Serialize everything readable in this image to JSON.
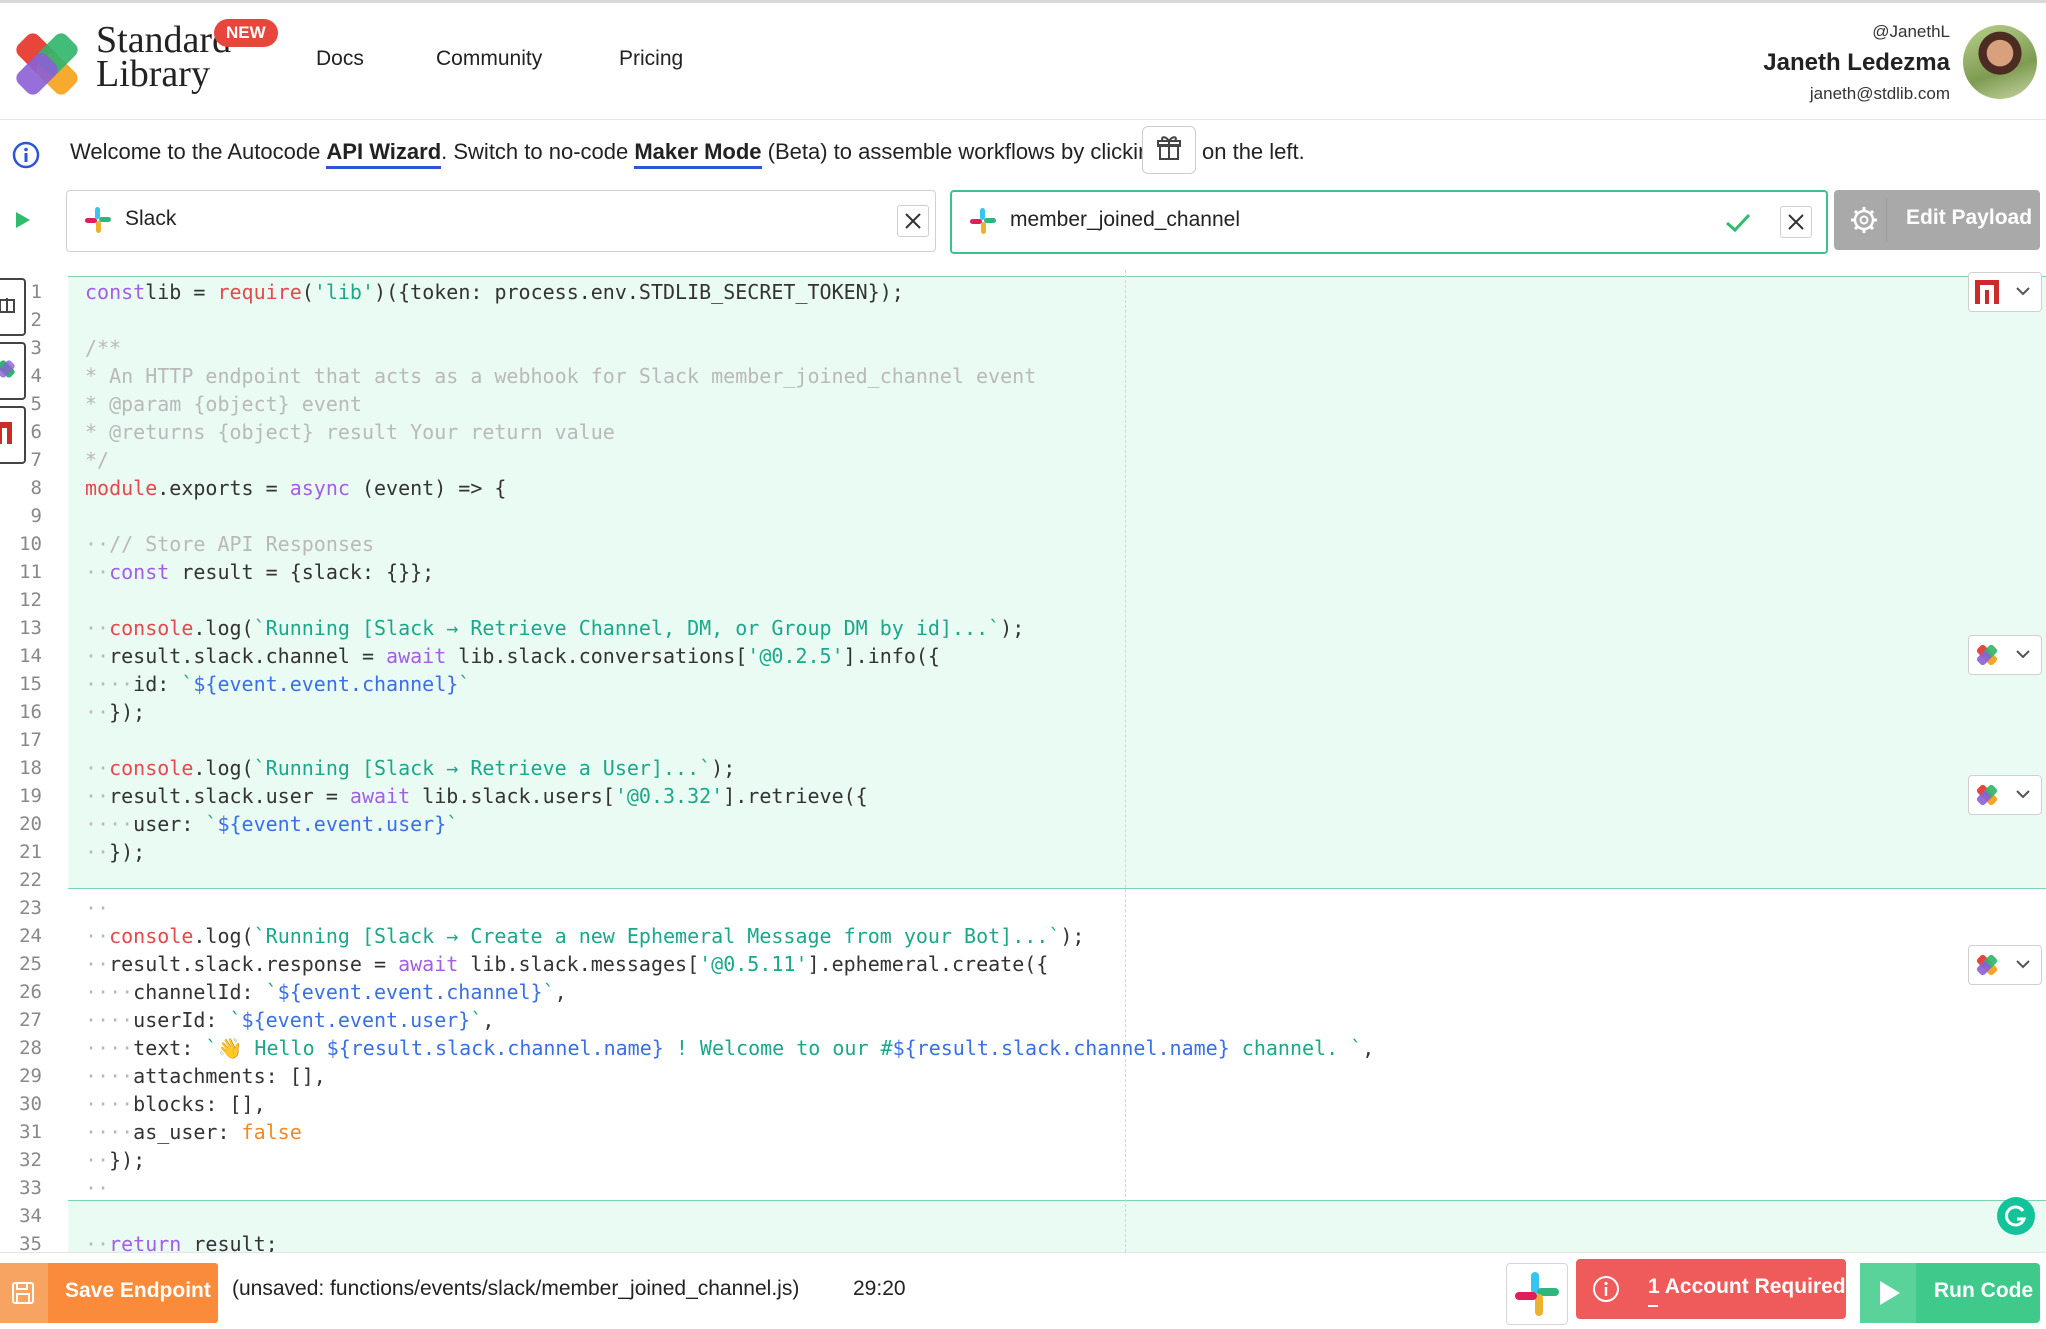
{
  "header": {
    "brand_line1": "Standard",
    "brand_line2": "Library",
    "new_badge": "NEW",
    "nav": [
      "Docs",
      "Community",
      "Pricing"
    ],
    "user": {
      "handle": "@JanethL",
      "name": "Janeth Ledezma",
      "email": "janeth@stdlib.com"
    }
  },
  "welcome": {
    "part1": "Welcome to the Autocode ",
    "api_wizard": "API Wizard",
    "part2": ". Switch to no-code ",
    "maker_mode": "Maker Mode",
    "part3": " (Beta) to assemble workflows by clicking",
    "part4": "on the left."
  },
  "selectors": {
    "api": "Slack",
    "event": "member_joined_channel",
    "edit_payload": "Edit Payload"
  },
  "editor": {
    "lines": [
      {
        "n": "1",
        "t": [
          [
            "k-kw",
            "const"
          ],
          [
            "",
            "lib = "
          ],
          [
            "k-red",
            "require"
          ],
          [
            "",
            "("
          ],
          [
            "k-str",
            "'lib'"
          ],
          [
            "",
            ")({token: process.env.STDLIB_SECRET_TOKEN});"
          ]
        ]
      },
      {
        "n": "2",
        "t": []
      },
      {
        "n": "3",
        "t": [
          [
            "k-com",
            "/**"
          ]
        ]
      },
      {
        "n": "4",
        "t": [
          [
            "k-com",
            "* An HTTP endpoint that acts as a webhook for Slack member_joined_channel event"
          ]
        ]
      },
      {
        "n": "5",
        "t": [
          [
            "k-com",
            "* @param {object} event"
          ]
        ]
      },
      {
        "n": "6",
        "t": [
          [
            "k-com",
            "* @returns {object} result Your return value"
          ]
        ]
      },
      {
        "n": "7",
        "t": [
          [
            "k-com",
            "*/"
          ]
        ]
      },
      {
        "n": "8",
        "t": [
          [
            "k-red",
            "module"
          ],
          [
            "",
            ".exports = "
          ],
          [
            "k-kw",
            "async"
          ],
          [
            "",
            " (event) => {"
          ]
        ]
      },
      {
        "n": "9",
        "t": []
      },
      {
        "n": "10",
        "t": [
          [
            "k-com",
            "··// Store API Responses"
          ]
        ]
      },
      {
        "n": "11",
        "t": [
          [
            "k-com",
            "··"
          ],
          [
            "k-kw",
            "const"
          ],
          [
            "",
            " result = {slack: {}};"
          ]
        ]
      },
      {
        "n": "12",
        "t": []
      },
      {
        "n": "13",
        "t": [
          [
            "k-com",
            "··"
          ],
          [
            "k-red",
            "console"
          ],
          [
            "",
            ".log("
          ],
          [
            "k-str",
            "`Running [Slack → Retrieve Channel, DM, or Group DM by id]...`"
          ],
          [
            "",
            ");"
          ]
        ]
      },
      {
        "n": "14",
        "t": [
          [
            "k-com",
            "··"
          ],
          [
            "",
            "result.slack.channel = "
          ],
          [
            "k-kw",
            "await"
          ],
          [
            "",
            " lib.slack.conversations["
          ],
          [
            "k-str",
            "'@0.2.5'"
          ],
          [
            "",
            "].info({"
          ]
        ]
      },
      {
        "n": "15",
        "t": [
          [
            "k-com",
            "····"
          ],
          [
            "",
            "id: "
          ],
          [
            "k-str",
            "`"
          ],
          [
            "k-tpl",
            "${event.event.channel}"
          ],
          [
            "k-str",
            "`"
          ]
        ]
      },
      {
        "n": "16",
        "t": [
          [
            "k-com",
            "··"
          ],
          [
            "",
            "});"
          ]
        ]
      },
      {
        "n": "17",
        "t": []
      },
      {
        "n": "18",
        "t": [
          [
            "k-com",
            "··"
          ],
          [
            "k-red",
            "console"
          ],
          [
            "",
            ".log("
          ],
          [
            "k-str",
            "`Running [Slack → Retrieve a User]...`"
          ],
          [
            "",
            ");"
          ]
        ]
      },
      {
        "n": "19",
        "t": [
          [
            "k-com",
            "··"
          ],
          [
            "",
            "result.slack.user = "
          ],
          [
            "k-kw",
            "await"
          ],
          [
            "",
            " lib.slack.users["
          ],
          [
            "k-str",
            "'@0.3.32'"
          ],
          [
            "",
            "].retrieve({"
          ]
        ]
      },
      {
        "n": "20",
        "t": [
          [
            "k-com",
            "····"
          ],
          [
            "",
            "user: "
          ],
          [
            "k-str",
            "`"
          ],
          [
            "k-tpl",
            "${event.event.user}"
          ],
          [
            "k-str",
            "`"
          ]
        ]
      },
      {
        "n": "21",
        "t": [
          [
            "k-com",
            "··"
          ],
          [
            "",
            "});"
          ]
        ]
      },
      {
        "n": "22",
        "t": []
      },
      {
        "n": "23",
        "t": [
          [
            "k-com",
            "··"
          ]
        ]
      },
      {
        "n": "24",
        "t": [
          [
            "k-com",
            "··"
          ],
          [
            "k-red",
            "console"
          ],
          [
            "",
            ".log("
          ],
          [
            "k-str",
            "`Running [Slack → Create a new Ephemeral Message from your Bot]...`"
          ],
          [
            "",
            ");"
          ]
        ]
      },
      {
        "n": "25",
        "t": [
          [
            "k-com",
            "··"
          ],
          [
            "",
            "result.slack.response = "
          ],
          [
            "k-kw",
            "await"
          ],
          [
            "",
            " lib.slack.messages["
          ],
          [
            "k-str",
            "'@0.5.11'"
          ],
          [
            "",
            "].ephemeral.create({"
          ]
        ]
      },
      {
        "n": "26",
        "t": [
          [
            "k-com",
            "····"
          ],
          [
            "",
            "channelId: "
          ],
          [
            "k-str",
            "`"
          ],
          [
            "k-tpl",
            "${event.event.channel}"
          ],
          [
            "k-str",
            "`"
          ],
          [
            "",
            ","
          ]
        ]
      },
      {
        "n": "27",
        "t": [
          [
            "k-com",
            "····"
          ],
          [
            "",
            "userId: "
          ],
          [
            "k-str",
            "`"
          ],
          [
            "k-tpl",
            "${event.event.user}"
          ],
          [
            "k-str",
            "`"
          ],
          [
            "",
            ","
          ]
        ]
      },
      {
        "n": "28",
        "t": [
          [
            "k-com",
            "····"
          ],
          [
            "",
            "text: "
          ],
          [
            "k-str",
            "`👋 Hello "
          ],
          [
            "k-tpl",
            "${result.slack.channel.name}"
          ],
          [
            "k-str",
            " ! Welcome to our #"
          ],
          [
            "k-tpl",
            "${result.slack.channel.name}"
          ],
          [
            "k-str",
            " channel. `"
          ],
          [
            "",
            ","
          ]
        ]
      },
      {
        "n": "29",
        "t": [
          [
            "k-com",
            "····"
          ],
          [
            "",
            "attachments: [],"
          ]
        ]
      },
      {
        "n": "30",
        "t": [
          [
            "k-com",
            "····"
          ],
          [
            "",
            "blocks: [],"
          ]
        ]
      },
      {
        "n": "31",
        "t": [
          [
            "k-com",
            "····"
          ],
          [
            "",
            "as_user: "
          ],
          [
            "k-or",
            "false"
          ]
        ]
      },
      {
        "n": "32",
        "t": [
          [
            "k-com",
            "··"
          ],
          [
            "",
            "});"
          ]
        ]
      },
      {
        "n": "33",
        "t": [
          [
            "k-com",
            "··"
          ]
        ]
      },
      {
        "n": "34",
        "t": []
      },
      {
        "n": "35",
        "t": [
          [
            "k-com",
            "··"
          ],
          [
            "k-kw",
            "return"
          ],
          [
            "",
            " result;"
          ]
        ]
      }
    ]
  },
  "footer": {
    "save": "Save Endpoint",
    "file": "(unsaved: functions/events/slack/member_joined_channel.js)",
    "cursor": "29:20",
    "account_required": "1 Account Required",
    "run_code": "Run Code"
  }
}
